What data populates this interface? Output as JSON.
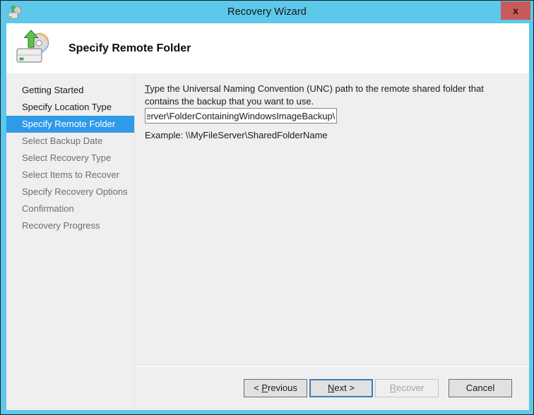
{
  "window": {
    "title": "Recovery Wizard",
    "title_icon": "recovery-drive-icon",
    "close_label": "x",
    "frame_color": "#5cc8ea",
    "titlebar_color": "#5cc8ea",
    "close_button_color": "#c75b5b"
  },
  "header": {
    "icon": "recovery-drive-disc-icon",
    "title": "Specify Remote Folder"
  },
  "sidebar": {
    "accent_color": "#2f9ae8",
    "items": [
      {
        "label": "Getting Started",
        "state": "done"
      },
      {
        "label": "Specify Location Type",
        "state": "done"
      },
      {
        "label": "Specify Remote Folder",
        "state": "current"
      },
      {
        "label": "Select Backup Date",
        "state": "upcoming"
      },
      {
        "label": "Select Recovery Type",
        "state": "upcoming"
      },
      {
        "label": "Select Items to Recover",
        "state": "upcoming"
      },
      {
        "label": "Specify Recovery Options",
        "state": "upcoming"
      },
      {
        "label": "Confirmation",
        "state": "upcoming"
      },
      {
        "label": "Recovery Progress",
        "state": "upcoming"
      }
    ]
  },
  "content": {
    "instruction_accesskey": "T",
    "instruction_rest": "ype the Universal Naming Convention (UNC) path to the remote shared folder that contains the backup that you want to use.",
    "unc_path_value": "\\\\MyServer\\FolderContainingWindowsImageBackup\\",
    "unc_path_placeholder": "",
    "example_text": "Example: \\\\MyFileServer\\SharedFolderName"
  },
  "buttons": {
    "previous": {
      "prefix": "< ",
      "accesskey": "P",
      "rest": "revious",
      "enabled": true,
      "default": false
    },
    "next": {
      "prefix": "",
      "accesskey": "N",
      "rest": "ext >",
      "enabled": true,
      "default": true
    },
    "recover": {
      "prefix": "",
      "accesskey": "R",
      "rest": "ecover",
      "enabled": false,
      "default": false
    },
    "cancel": {
      "prefix": "",
      "accesskey": "",
      "rest": "Cancel",
      "enabled": true,
      "default": false
    }
  }
}
